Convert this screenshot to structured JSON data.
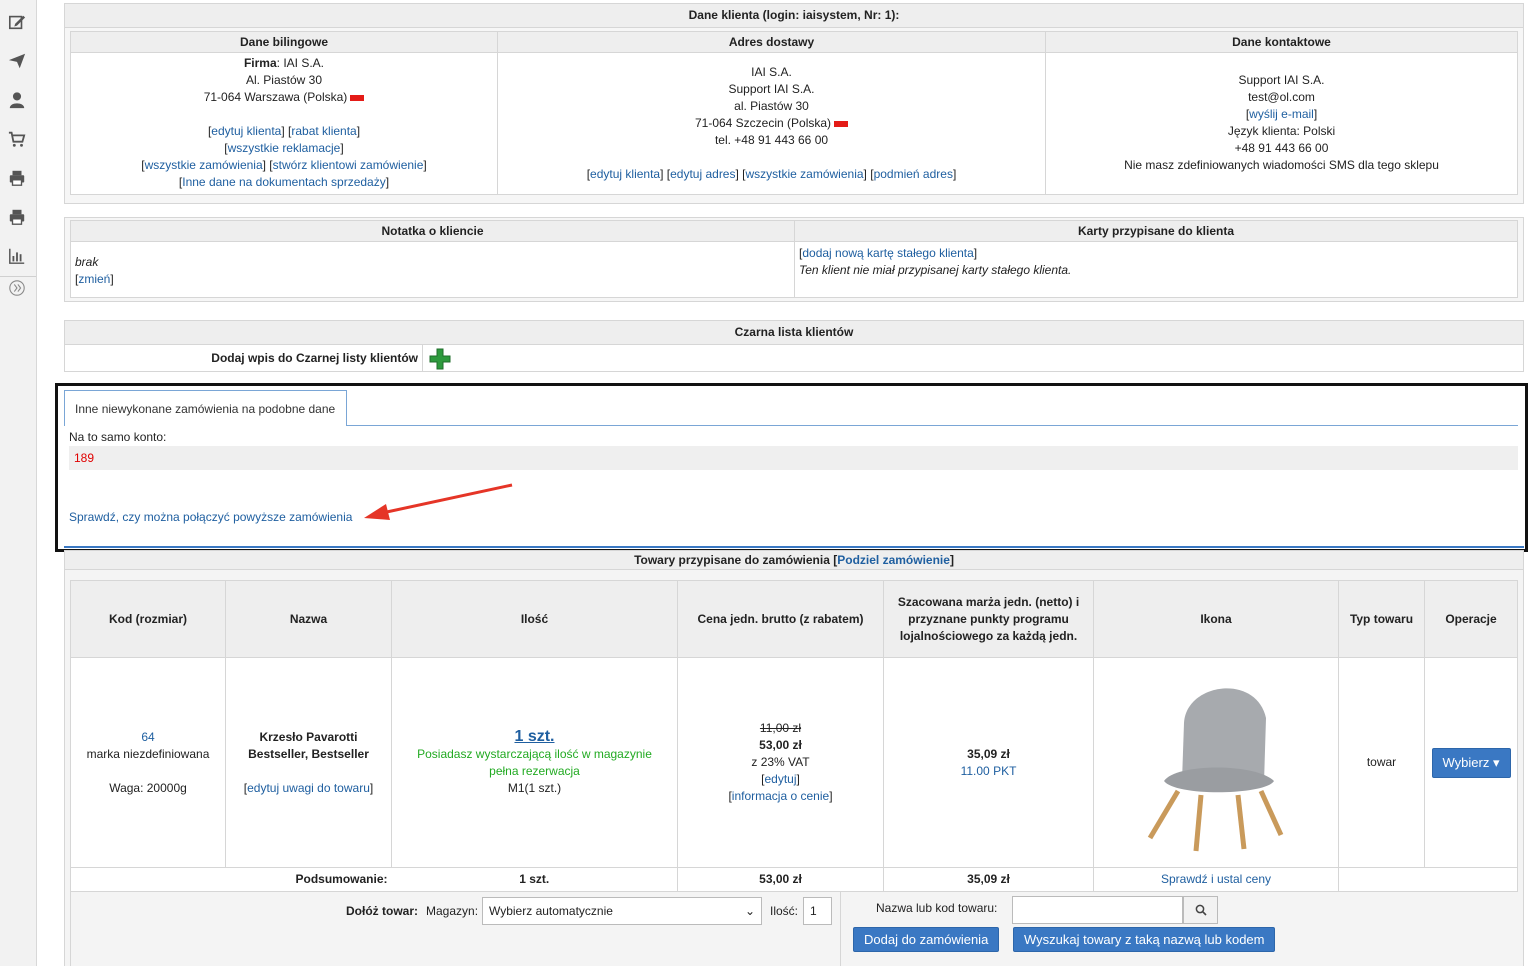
{
  "sidebar": {
    "icons": [
      "edit-icon",
      "send-icon",
      "user-icon",
      "cart-icon",
      "print-icon",
      "print-icon",
      "chart-icon",
      "expand-icon"
    ]
  },
  "client": {
    "header": "Dane klienta (login: iaisystem, Nr: 1):",
    "billing": {
      "title": "Dane bilingowe",
      "firma_label": "Firma",
      "firma_value": ": IAI S.A.",
      "street": "Al. Piastów 30",
      "city": "71-064 Warszawa (Polska)",
      "links_row1": [
        "edytuj klienta",
        "rabat klienta"
      ],
      "links_row2": [
        "wszystkie reklamacje"
      ],
      "links_row3": [
        "wszystkie zamówienia",
        "stwórz klientowi zamówienie"
      ],
      "links_row4": [
        "Inne dane na dokumentach sprzedaży"
      ]
    },
    "delivery": {
      "title": "Adres dostawy",
      "line1": "IAI S.A.",
      "line2": "Support IAI S.A.",
      "line3": "al. Piastów 30",
      "line4": "71-064 Szczecin (Polska)",
      "line5": "tel. +48 91 443 66 00",
      "links": [
        "edytuj klienta",
        "edytuj adres",
        "wszystkie zamówienia",
        "podmień adres"
      ]
    },
    "contact": {
      "title": "Dane kontaktowe",
      "line1": "Support IAI S.A.",
      "line2": "test@ol.com",
      "email_link": "wyślij e-mail",
      "line4": "Język klienta: Polski",
      "line5": "+48 91 443 66 00",
      "line6": "Nie masz zdefiniowanych wiadomości SMS dla tego sklepu"
    }
  },
  "note": {
    "title": "Notatka o kliencie",
    "value": "brak",
    "change_link": "zmień"
  },
  "cards": {
    "title": "Karty przypisane do klienta",
    "add_link": "dodaj nową kartę stałego klienta",
    "info": "Ten klient nie miał przypisanej karty stałego klienta."
  },
  "blacklist": {
    "title": "Czarna lista klientów",
    "add_label": "Dodaj wpis do Czarnej listy klientów"
  },
  "other_orders": {
    "tab_label": "Inne niewykonane zamówienia na podobne dane",
    "same_account_label": "Na to samo konto:",
    "order_number": "189",
    "merge_link": "Sprawdź, czy można połączyć powyższe zamówienia"
  },
  "products": {
    "header": "Towary przypisane do zamówienia",
    "split_link": "Podziel zamówienie",
    "columns": [
      "Kod (rozmiar)",
      "Nazwa",
      "Ilość",
      "Cena jedn. brutto (z rabatem)",
      "Szacowana marża jedn. (netto) i przyznane punkty programu lojalnościowego za każdą jedn.",
      "Ikona",
      "Typ towaru",
      "Operacje"
    ],
    "row": {
      "code": "64",
      "brand": "marka niezdefiniowana",
      "weight": "Waga: 20000g",
      "name": "Krzesło Pavarotti Bestseller, Bestseller",
      "edit_notes_link": "edytuj uwagi do towaru",
      "qty": "1 szt.",
      "stock_msg1": "Posiadasz wystarczającą ilość w magazynie",
      "stock_msg2": "pełna rezerwacja",
      "warehouse": "M1(1 szt.)",
      "old_price": "11,00 zł",
      "price": "53,00 zł",
      "vat": "z 23% VAT",
      "edit_link": "edytuj",
      "price_info_link": "informacja o cenie",
      "margin": "35,09 zł",
      "points": "11.00 PKT",
      "type": "towar",
      "select_button": "Wybierz"
    },
    "summary": {
      "label": "Podsumowanie:",
      "qty": "1 szt.",
      "price": "53,00 zł",
      "margin": "35,09 zł",
      "check_link": "Sprawdź i ustal ceny"
    },
    "add_item": {
      "label": "Dołóż towar:",
      "warehouse_label": "Magazyn:",
      "warehouse_value": "Wybierz automatycznie",
      "qty_label": "Ilość:",
      "qty_value": "1",
      "search_label": "Nazwa lub kod towaru:",
      "search_value": "",
      "add_button": "Dodaj do zamówienia",
      "search_button": "Wyszukaj towary z taką nazwą lub kodem"
    }
  },
  "colors": {
    "link": "#1f5fa0",
    "accent_button": "#3a78c3",
    "stock_ok": "#22aa22",
    "order_red": "#e00000",
    "flag_red": "#e41b17"
  }
}
